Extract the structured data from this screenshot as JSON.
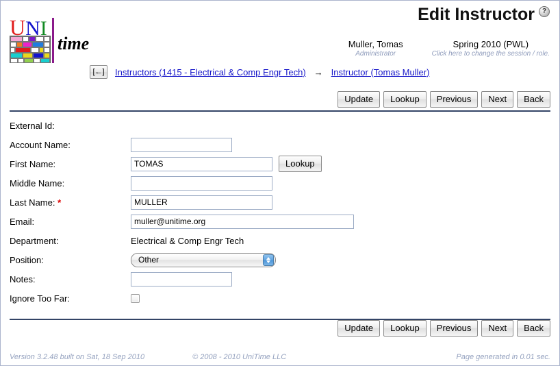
{
  "page": {
    "title": "Edit Instructor",
    "help_icon_glyph": "?",
    "help_icon_name": "help-icon"
  },
  "logo": {
    "uni_u": "U",
    "uni_n": "N",
    "uni_i": "I",
    "time": "time"
  },
  "user": {
    "name": "Muller, Tomas",
    "role": "Administrator",
    "session": "Spring 2010 (PWL)",
    "session_hint": "Click here to change the session / role."
  },
  "breadcrumb": {
    "back_label": "[←]",
    "items": [
      {
        "label": "Instructors (1415 - Electrical & Comp Engr Tech)",
        "link": true
      },
      {
        "label": "→",
        "link": false
      },
      {
        "label": "Instructor (Tomas Muller)",
        "link": true
      }
    ]
  },
  "toolbar": {
    "update_label": "Update",
    "lookup_label": "Lookup",
    "previous_label": "Previous",
    "next_label": "Next",
    "back_label": "Back"
  },
  "form": {
    "external_id": {
      "label": "External Id:",
      "value": ""
    },
    "account_name": {
      "label": "Account Name:",
      "value": "",
      "placeholder": ""
    },
    "first_name": {
      "label": "First Name:",
      "value": "TOMAS",
      "placeholder": "",
      "lookup_label": "Lookup"
    },
    "middle_name": {
      "label": "Middle Name:",
      "value": "",
      "placeholder": ""
    },
    "last_name": {
      "label": "Last Name:",
      "label_required": "*",
      "value": "MULLER",
      "placeholder": ""
    },
    "email": {
      "label": "Email:",
      "value": "muller@unitime.org",
      "placeholder": ""
    },
    "department": {
      "label": "Department:",
      "value": "Electrical & Comp Engr Tech"
    },
    "position": {
      "label": "Position:",
      "value": "Other"
    },
    "notes": {
      "label": "Notes:",
      "value": "",
      "placeholder": ""
    },
    "ignore_too_far": {
      "label": "Ignore Too Far:",
      "checked": false
    }
  },
  "footer": {
    "version": "Version 3.2.48 built on Sat, 18 Sep 2010",
    "copyright": "© 2008 - 2010 UniTime LLC",
    "generated": "Page generated in 0.01 sec."
  },
  "colors": {
    "link": "#1616c9",
    "rule": "#334466",
    "required": "#dd0000",
    "footer_text": "#95a2bf",
    "input_border": "#9aaac4"
  }
}
